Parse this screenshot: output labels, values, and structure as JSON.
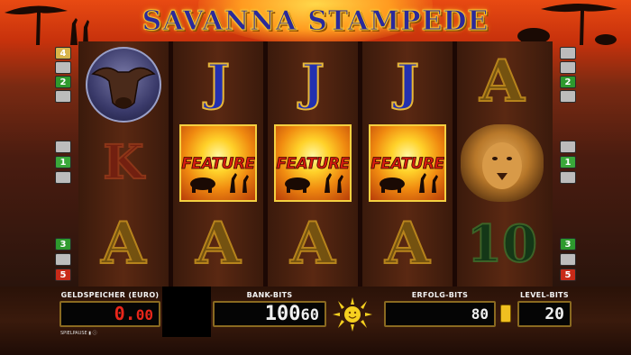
{
  "game": {
    "title": "SAVANNA STAMPEDE"
  },
  "reels": [
    {
      "symbols": [
        {
          "name": "buffalo"
        },
        {
          "name": "K",
          "text": "K"
        },
        {
          "name": "A",
          "text": "A"
        }
      ]
    },
    {
      "symbols": [
        {
          "name": "J",
          "text": "J"
        },
        {
          "name": "feature",
          "text": "FEATURE"
        },
        {
          "name": "A",
          "text": "A"
        }
      ]
    },
    {
      "symbols": [
        {
          "name": "J",
          "text": "J"
        },
        {
          "name": "feature",
          "text": "FEATURE"
        },
        {
          "name": "A",
          "text": "A"
        }
      ]
    },
    {
      "symbols": [
        {
          "name": "J",
          "text": "J"
        },
        {
          "name": "feature",
          "text": "FEATURE"
        },
        {
          "name": "A",
          "text": "A"
        }
      ]
    },
    {
      "symbols": [
        {
          "name": "A",
          "text": "A"
        },
        {
          "name": "lion"
        },
        {
          "name": "10",
          "text": "10"
        }
      ]
    }
  ],
  "line_markers": {
    "left": [
      "4",
      "2",
      "",
      "",
      "1",
      "",
      "3",
      "",
      "5"
    ],
    "right": [
      "",
      "",
      "2",
      "",
      "",
      "1",
      "",
      "3",
      "5"
    ]
  },
  "panel": {
    "credit": {
      "label": "GELDSPEICHER (EURO)",
      "value_main": "0.",
      "value_dec": "00"
    },
    "bank": {
      "label": "BANK-BITS",
      "value_main": "100",
      "value_small": "60"
    },
    "win": {
      "label": "ERFOLG-BITS",
      "value": "80"
    },
    "level": {
      "label": "LEVEL-BITS",
      "value": "20"
    },
    "tiny_text": "SPIELPAUSE  ▮  ⓘ"
  },
  "colors": {
    "accent_gold": "#f6c230",
    "credit_red": "#e8261a",
    "panel_border": "#8a6a20"
  }
}
